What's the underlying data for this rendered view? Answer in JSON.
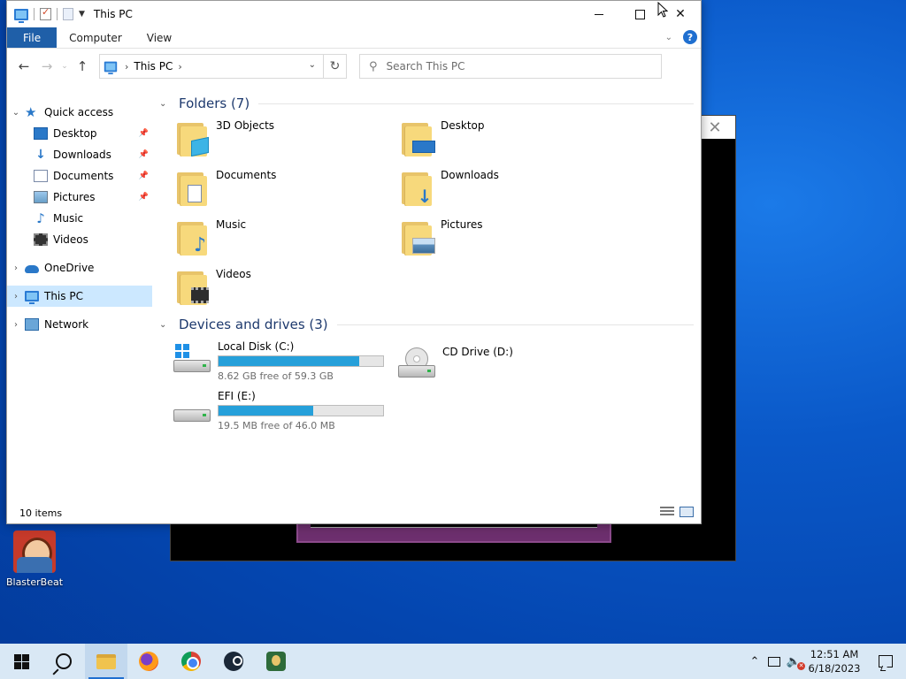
{
  "window": {
    "title": "This PC",
    "controls": {
      "minimize": "",
      "maximize": "",
      "close": "✕"
    }
  },
  "ribbon": {
    "tabs": [
      "File",
      "Computer",
      "View"
    ],
    "help": "?"
  },
  "address": {
    "location": "This PC",
    "search_placeholder": "Search This PC"
  },
  "nav": {
    "quick_access": "Quick access",
    "quick_items": [
      "Desktop",
      "Downloads",
      "Documents",
      "Pictures",
      "Music",
      "Videos"
    ],
    "onedrive": "OneDrive",
    "this_pc": "This PC",
    "network": "Network"
  },
  "folders": {
    "header": "Folders (7)",
    "items": [
      "3D Objects",
      "Desktop",
      "Documents",
      "Downloads",
      "Music",
      "Pictures",
      "Videos"
    ]
  },
  "drives": {
    "header": "Devices and drives (3)",
    "items": [
      {
        "name": "Local Disk (C:)",
        "free": "8.62 GB free of 59.3 GB",
        "used_fraction": 0.855
      },
      {
        "name": "CD Drive (D:)"
      },
      {
        "name": "EFI (E:)",
        "free": "19.5 MB free of 46.0 MB",
        "used_fraction": 0.576
      }
    ]
  },
  "status": {
    "items": "10 items"
  },
  "desktop": {
    "icon_label": "BlasterBeat"
  },
  "taskbar": {
    "time": "12:51 AM",
    "date": "6/18/2023"
  },
  "colors": {
    "accent": "#1f5fa8",
    "selection": "#cce8ff",
    "drive_bar": "#26a0da"
  }
}
